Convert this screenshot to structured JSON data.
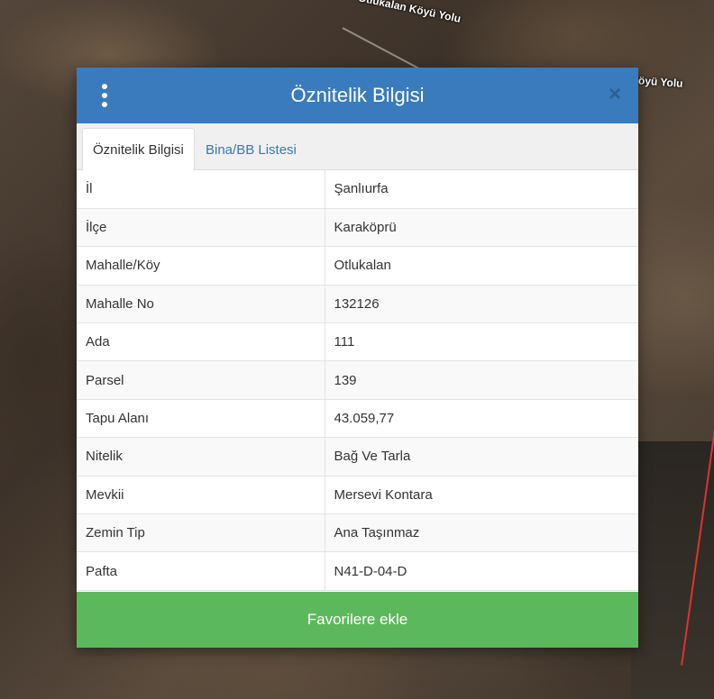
{
  "map": {
    "road_label_1": "Otlukalan Köyü Yolu",
    "road_label_2": "öyü Yolu"
  },
  "modal": {
    "title": "Öznitelik Bilgisi",
    "close_glyph": "×",
    "tabs": [
      {
        "label": "Öznitelik Bilgisi",
        "active": true
      },
      {
        "label": "Bina/BB Listesi",
        "active": false
      }
    ],
    "rows": [
      {
        "key": "İl",
        "value": "Şanlıurfa"
      },
      {
        "key": "İlçe",
        "value": "Karaköprü"
      },
      {
        "key": "Mahalle/Köy",
        "value": "Otlukalan"
      },
      {
        "key": "Mahalle No",
        "value": "132126"
      },
      {
        "key": "Ada",
        "value": "111"
      },
      {
        "key": "Parsel",
        "value": "139"
      },
      {
        "key": "Tapu Alanı",
        "value": "43.059,77"
      },
      {
        "key": "Nitelik",
        "value": "Bağ Ve Tarla"
      },
      {
        "key": "Mevkii",
        "value": "Mersevi Kontara"
      },
      {
        "key": "Zemin Tip",
        "value": "Ana Taşınmaz"
      },
      {
        "key": "Pafta",
        "value": "N41-D-04-D"
      }
    ],
    "favorite_button": "Favorilere ekle"
  },
  "colors": {
    "header": "#3a7bbd",
    "favorite": "#5cb85c",
    "tab_link": "#337ab7"
  },
  "icons": {
    "menu": "kebab-menu-icon",
    "close": "close-icon"
  }
}
